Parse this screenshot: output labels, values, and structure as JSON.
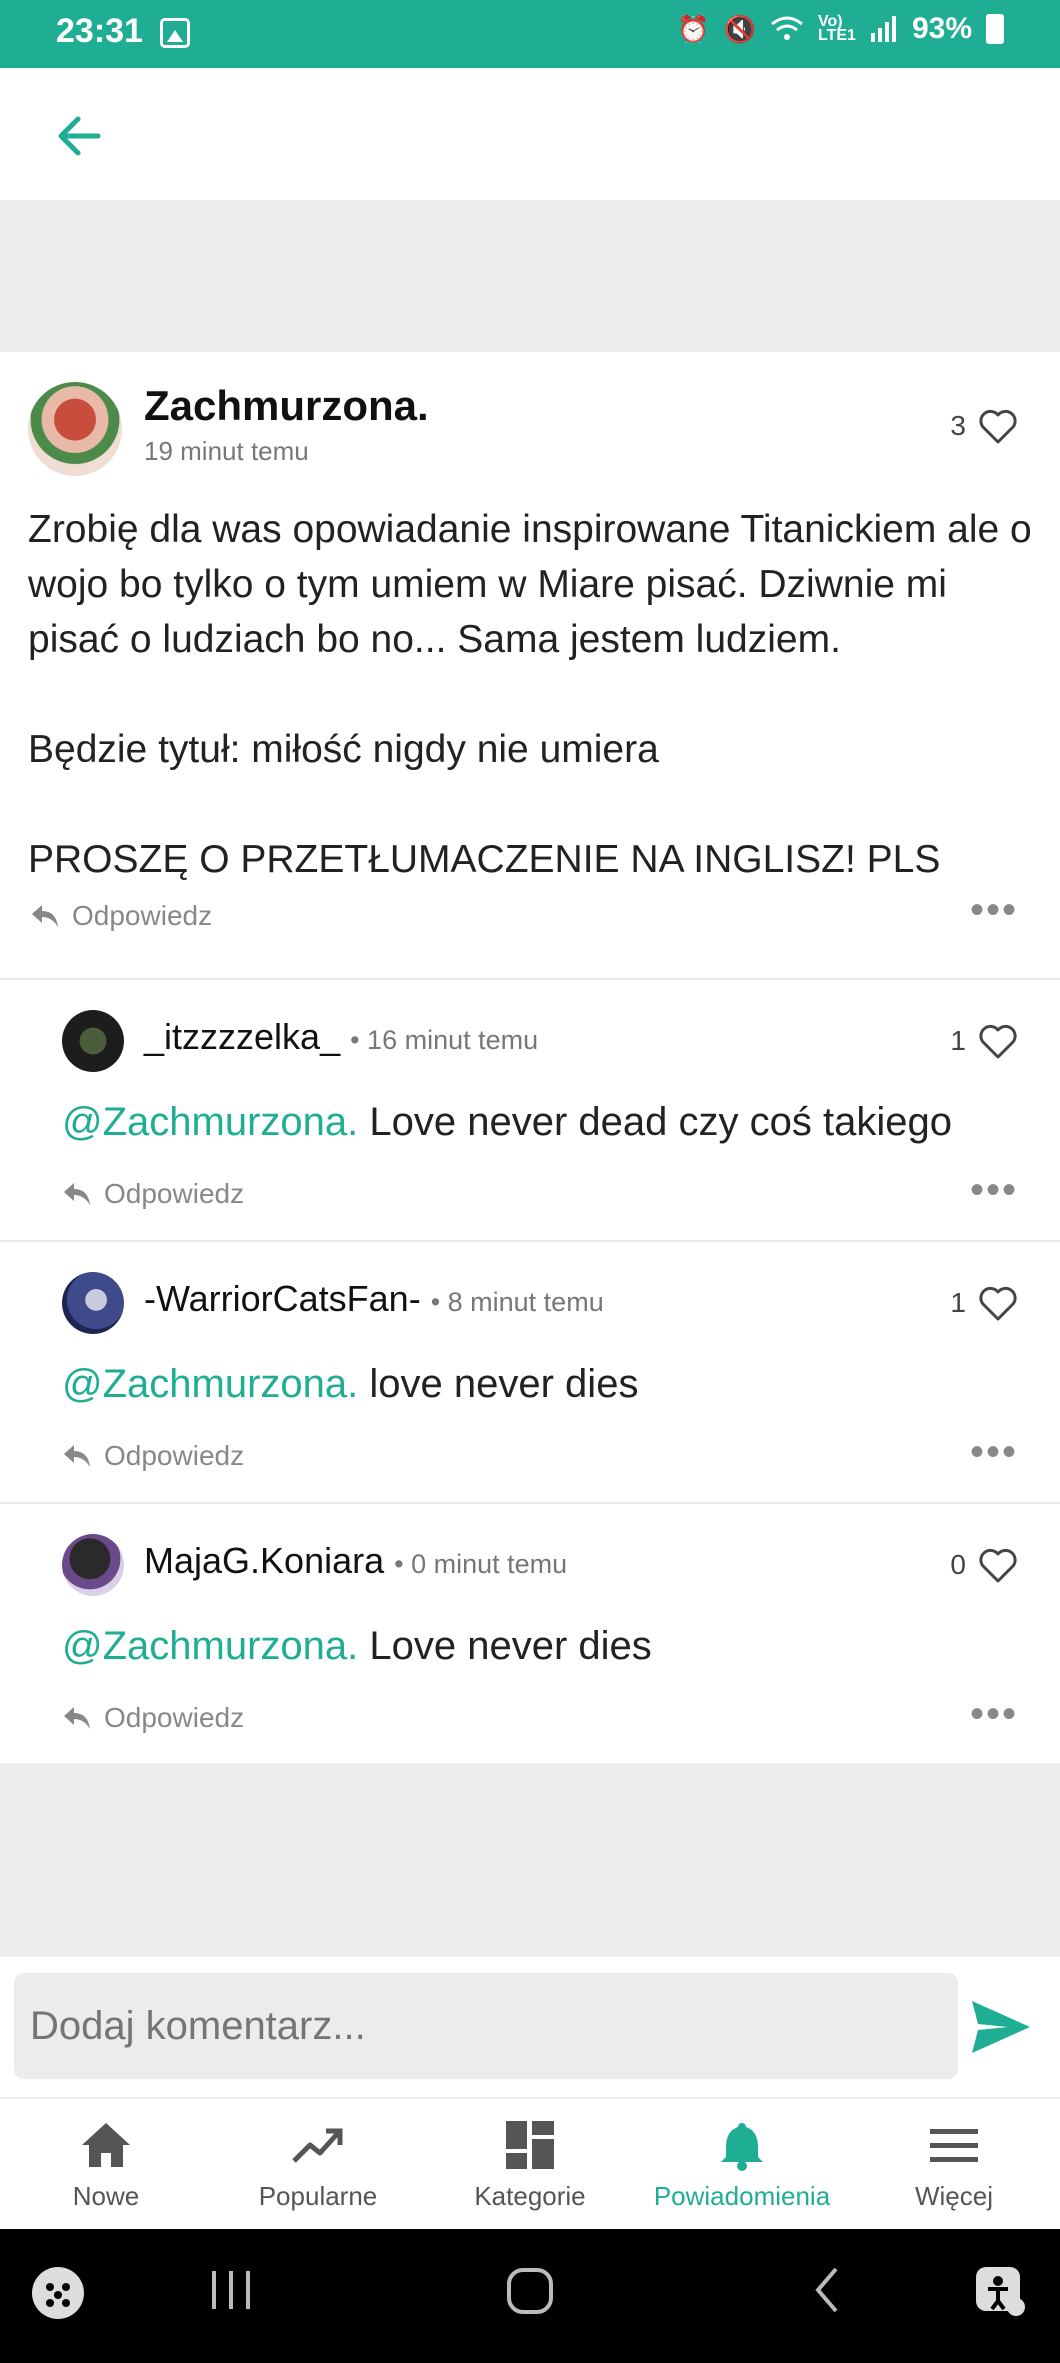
{
  "status_bar": {
    "time": "23:31",
    "battery": "93%",
    "icons": [
      "image-icon",
      "alarm-icon",
      "mute-icon",
      "wifi-icon",
      "volte-icon",
      "signal-icon",
      "battery-icon"
    ]
  },
  "header": {
    "back_icon": "arrow-left-icon"
  },
  "post": {
    "author": "Zachmurzona.",
    "time": "19 minut temu",
    "likes": "3",
    "body": "Zrobię dla was opowiadanie inspirowane Titanickiem ale o wojo bo tylko o tym umiem w Miare pisać. Dziwnie mi pisać o ludziach bo no... Sama jestem ludziem.\n\nBędzie tytuł: miłość nigdy nie umiera\n\nPROSZĘ O PRZETŁUMACZENIE NA INGLISZ! PLS",
    "reply_label": "Odpowiedz"
  },
  "comments": [
    {
      "author": "_itzzzzelka_",
      "time": "• 16 minut temu",
      "likes": "1",
      "mention": "@Zachmurzona.",
      "text": " Love never dead czy coś takiego",
      "reply_label": "Odpowiedz"
    },
    {
      "author": "-WarriorCatsFan-",
      "time": "• 8 minut temu",
      "likes": "1",
      "mention": "@Zachmurzona.",
      "text": " love never dies",
      "reply_label": "Odpowiedz"
    },
    {
      "author": "MajaG.Koniara",
      "time": "• 0 minut temu",
      "likes": "0",
      "mention": "@Zachmurzona.",
      "text": " Love never dies",
      "reply_label": "Odpowiedz"
    }
  ],
  "composer": {
    "placeholder": "Dodaj komentarz..."
  },
  "bottom_nav": [
    {
      "label": "Nowe",
      "icon": "home-icon"
    },
    {
      "label": "Popularne",
      "icon": "trending-icon"
    },
    {
      "label": "Kategorie",
      "icon": "grid-icon"
    },
    {
      "label": "Powiadomienia",
      "icon": "bell-icon",
      "active": true
    },
    {
      "label": "Więcej",
      "icon": "menu-icon"
    }
  ],
  "colors": {
    "accent": "#1fae93",
    "background_gray": "#ebecec"
  }
}
